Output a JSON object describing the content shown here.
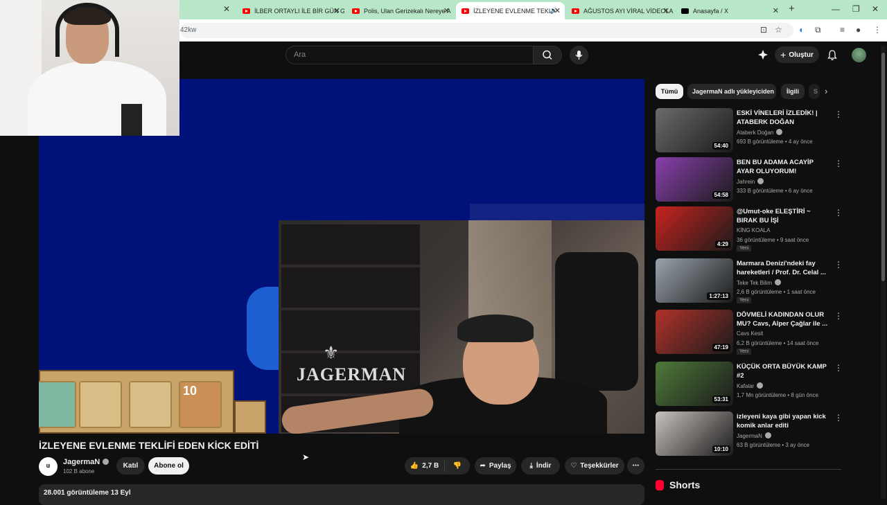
{
  "browser": {
    "tabs": [
      {
        "label": "İLBER ORTAYLI İLE BİR GÜN GE",
        "icon": "youtube-icon",
        "active": false
      },
      {
        "label": "Polis, Ulan Gerizekalı Nereye A",
        "icon": "youtube-icon",
        "active": false
      },
      {
        "label": "İZLEYENE EVLENME TEKLİF",
        "icon": "youtube-icon",
        "active": true
      },
      {
        "label": "AĞUSTOS AYI VİRAL VİDEOLAR",
        "icon": "youtube-icon",
        "active": false
      },
      {
        "label": "Anasayfa / X",
        "icon": "x-icon",
        "active": false
      }
    ],
    "url_fragment": "42kw"
  },
  "header": {
    "search_placeholder": "Ara",
    "create_label": "Oluştur"
  },
  "video": {
    "title": "İZLEYENE EVLENME TEKLİFİ EDEN KİCK EDİTİ",
    "watermark": "JAGERMAN",
    "hotbar_number": "10",
    "channel": {
      "name": "JagermaN",
      "subscribers": "102 B abone"
    },
    "join_label": "Katıl",
    "subscribe_label": "Abone ol",
    "likes": "2,7 B",
    "share_label": "Paylaş",
    "download_label": "İndir",
    "thanks_label": "Teşekkürler",
    "views_date": "28.001 görüntüleme  13 Eyl"
  },
  "sidebar": {
    "chips": [
      "Tümü",
      "JagermaN adlı yükleyiciden",
      "İlgili",
      "S"
    ],
    "recommendations": [
      {
        "title": "ESKİ VİNELERİ İZLEDİK! | ATABERK DOĞAN",
        "channel": "Ataberk Doğan",
        "verified": true,
        "meta": "693 B görüntüleme • 4 ay önce",
        "duration": "54:40",
        "new": false,
        "color": "#6b6b6b"
      },
      {
        "title": "BEN BU ADAMA ACAYİP AYAR OLUYORUM! @Ebonivon ...",
        "channel": "Jahrein",
        "verified": true,
        "meta": "333 B görüntüleme • 6 ay önce",
        "duration": "54:58",
        "new": false,
        "color": "#8a3fae"
      },
      {
        "title": "@Umut-oke  ELEŞTİRİ ~ BIRAK BU İŞİ",
        "channel": "KİNG KOALA",
        "verified": false,
        "meta": "36 görüntüleme • 9 saat önce",
        "duration": "4:29",
        "new": true,
        "color": "#c8231e"
      },
      {
        "title": "Marmara Denizi'ndeki fay hareketleri / Prof. Dr. Celal ...",
        "channel": "Teke Tek Bilim",
        "verified": true,
        "meta": "2,6 B görüntüleme • 1 saat önce",
        "duration": "1:27:13",
        "new": true,
        "color": "#9aa4ad"
      },
      {
        "title": "DÖVMELİ KADINDAN OLUR MU? Cavs, Alper Çağlar ile ...",
        "channel": "Cavs Kesit",
        "verified": false,
        "meta": "6,2 B görüntüleme • 14 saat önce",
        "duration": "47:19",
        "new": true,
        "color": "#b2322a"
      },
      {
        "title": "KÜÇÜK ORTA BÜYÜK KAMP #2",
        "channel": "Kafalar",
        "verified": true,
        "meta": "1,7 Mn görüntüleme • 8 gün önce",
        "duration": "53:31",
        "new": false,
        "color": "#4f7a3a"
      },
      {
        "title": "izleyeni kaya gibi yapan kick komik anlar editi",
        "channel": "JagermaN",
        "verified": true,
        "meta": "63 B görüntüleme • 3 ay önce",
        "duration": "10:10",
        "new": false,
        "color": "#c9c2bd"
      }
    ],
    "shorts_label": "Shorts"
  }
}
